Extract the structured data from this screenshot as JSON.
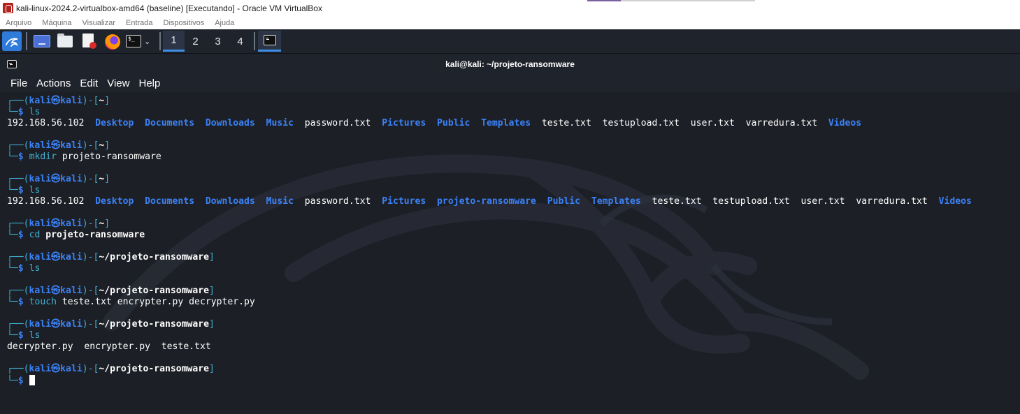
{
  "vbox": {
    "window_title": "kali-linux-2024.2-virtualbox-amd64 (baseline) [Executando] - Oracle VM VirtualBox",
    "menu": [
      "Arquivo",
      "Máquina",
      "Visualizar",
      "Entrada",
      "Dispositivos",
      "Ajuda"
    ]
  },
  "panel": {
    "workspaces": [
      "1",
      "2",
      "3",
      "4"
    ],
    "active_workspace": "1"
  },
  "terminal": {
    "title": "kali@kali: ~/projeto-ransomware",
    "menu": [
      "File",
      "Actions",
      "Edit",
      "View",
      "Help"
    ],
    "prompt_user": "kali",
    "prompt_host": "kali",
    "prompt_symbol": "㉿",
    "blocks": [
      {
        "cwd": "~",
        "command": "ls",
        "args": "",
        "output": [
          [
            {
              "t": "192.168.56.102",
              "k": "file"
            },
            {
              "t": "Desktop",
              "k": "dir"
            },
            {
              "t": "Documents",
              "k": "dir"
            },
            {
              "t": "Downloads",
              "k": "dir"
            },
            {
              "t": "Music",
              "k": "dir"
            },
            {
              "t": "password.txt",
              "k": "file"
            },
            {
              "t": "Pictures",
              "k": "dir"
            },
            {
              "t": "Public",
              "k": "dir"
            },
            {
              "t": "Templates",
              "k": "dir"
            },
            {
              "t": "teste.txt",
              "k": "file"
            },
            {
              "t": "testupload.txt",
              "k": "file"
            },
            {
              "t": "user.txt",
              "k": "file"
            },
            {
              "t": "varredura.txt",
              "k": "file"
            },
            {
              "t": "Videos",
              "k": "dir"
            }
          ]
        ]
      },
      {
        "cwd": "~",
        "command": "mkdir",
        "args": "projeto-ransomware",
        "output": []
      },
      {
        "cwd": "~",
        "command": "ls",
        "args": "",
        "output": [
          [
            {
              "t": "192.168.56.102",
              "k": "file"
            },
            {
              "t": "Desktop",
              "k": "dir"
            },
            {
              "t": "Documents",
              "k": "dir"
            },
            {
              "t": "Downloads",
              "k": "dir"
            },
            {
              "t": "Music",
              "k": "dir"
            },
            {
              "t": "password.txt",
              "k": "file"
            },
            {
              "t": "Pictures",
              "k": "dir"
            },
            {
              "t": "projeto-ransomware",
              "k": "dir"
            },
            {
              "t": "Public",
              "k": "dir"
            },
            {
              "t": "Templates",
              "k": "dir"
            },
            {
              "t": "teste.txt",
              "k": "file"
            },
            {
              "t": "testupload.txt",
              "k": "file"
            },
            {
              "t": "user.txt",
              "k": "file"
            },
            {
              "t": "varredura.txt",
              "k": "file"
            },
            {
              "t": "Videos",
              "k": "dir"
            }
          ]
        ]
      },
      {
        "cwd": "~",
        "command": "cd",
        "args": "projeto-ransomware",
        "args_bold": true,
        "output": []
      },
      {
        "cwd": "~/projeto-ransomware",
        "command": "ls",
        "args": "",
        "output": []
      },
      {
        "cwd": "~/projeto-ransomware",
        "command": "touch",
        "args": "teste.txt encrypter.py decrypter.py",
        "output": []
      },
      {
        "cwd": "~/projeto-ransomware",
        "command": "ls",
        "args": "",
        "output": [
          [
            {
              "t": "decrypter.py",
              "k": "file"
            },
            {
              "t": "encrypter.py",
              "k": "file"
            },
            {
              "t": "teste.txt",
              "k": "file"
            }
          ]
        ]
      },
      {
        "cwd": "~/projeto-ransomware",
        "command": "",
        "args": "",
        "cursor": true,
        "output": []
      }
    ],
    "colors": {
      "background": "#1d1f26",
      "prompt_frame": "#3fb0d0",
      "prompt_user": "#3b82f6",
      "directory": "#3b82f6",
      "text": "#ffffff"
    }
  }
}
